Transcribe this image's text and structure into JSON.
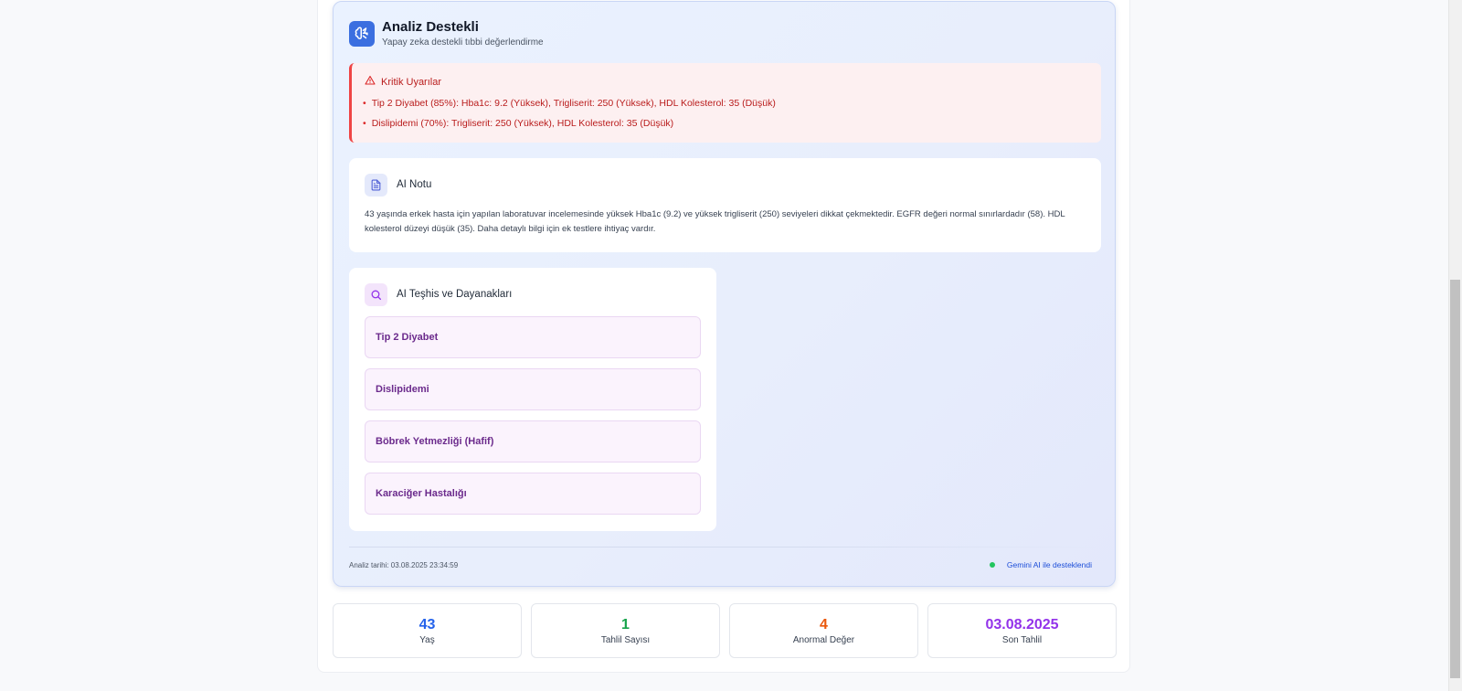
{
  "analysis": {
    "title": "Analiz Destekli",
    "subtitle": "Yapay zeka destekli tıbbi değerlendirme",
    "brand_icon": "brain-icon",
    "accent_color": "#3b6fe0"
  },
  "alerts": {
    "title": "Kritik Uyarılar",
    "icon": "warning-icon",
    "color": "#b91c1c",
    "items": [
      "Tip 2 Diyabet (85%): Hba1c: 9.2 (Yüksek), Trigliserit: 250 (Yüksek), HDL Kolesterol: 35 (Düşük)",
      "Dislipidemi (70%): Trigliserit: 250 (Yüksek), HDL Kolesterol: 35 (Düşük)"
    ]
  },
  "ai_note": {
    "title": "AI Notu",
    "icon": "document-icon",
    "text": "43 yaşında erkek hasta için yapılan laboratuvar incelemesinde yüksek Hba1c (9.2) ve yüksek trigliserit (250) seviyeleri dikkat çekmektedir. EGFR değeri normal sınırlardadır (58). HDL kolesterol düzeyi düşük (35). Daha detaylı bilgi için ek testlere ihtiyaç vardır."
  },
  "diagnoses": {
    "title": "AI Teşhis ve Dayanakları",
    "icon": "search-icon",
    "items": [
      "Tip 2 Diyabet",
      "Dislipidemi",
      "Böbrek Yetmezliği (Hafif)",
      "Karaciğer Hastalığı"
    ]
  },
  "footer": {
    "date": "Analiz tarihi: 03.08.2025 23:34:59",
    "powered_by": "Gemini AI ile desteklendi",
    "status_color": "#22c55e"
  },
  "stats": [
    {
      "value": "43",
      "label": "Yaş",
      "color": "#2563eb"
    },
    {
      "value": "1",
      "label": "Tahlil Sayısı",
      "color": "#16a34a"
    },
    {
      "value": "4",
      "label": "Anormal Değer",
      "color": "#ea580c"
    },
    {
      "value": "03.08.2025",
      "label": "Son Tahlil",
      "color": "#9333ea"
    }
  ]
}
